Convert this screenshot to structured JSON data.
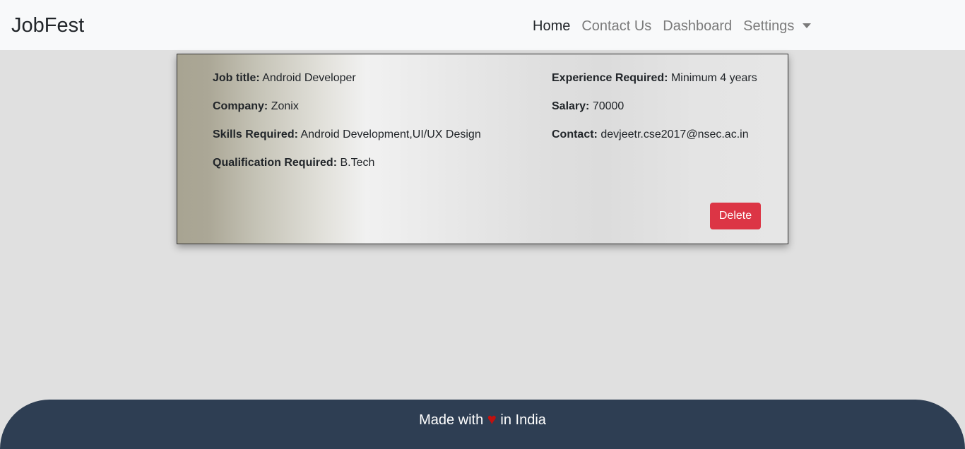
{
  "navbar": {
    "brand": "JobFest",
    "links": [
      {
        "label": "Home"
      },
      {
        "label": "Contact Us"
      },
      {
        "label": "Dashboard"
      },
      {
        "label": "Settings"
      }
    ]
  },
  "job": {
    "title_label": "Job title:",
    "title": "Android Developer",
    "company_label": "Company:",
    "company": "Zonix",
    "skills_label": "Skills Required:",
    "skills": "Android Development,UI/UX Design",
    "qualification_label": "Qualification Required:",
    "qualification": "B.Tech",
    "experience_label": "Experience Required:",
    "experience": "Minimum 4 years",
    "salary_label": "Salary:",
    "salary": "70000",
    "contact_label": "Contact:",
    "contact": "devjeetr.cse2017@nsec.ac.in",
    "delete_label": "Delete"
  },
  "footer": {
    "prefix": "Made with",
    "heart": "♥",
    "suffix": "in India",
    "heart_color": "#c0110f"
  },
  "colors": {
    "navbar_bg": "#f8f9fa",
    "page_bg": "#e0e0e0",
    "delete_button": "#dc3545",
    "footer_bg": "#2e3e53"
  }
}
